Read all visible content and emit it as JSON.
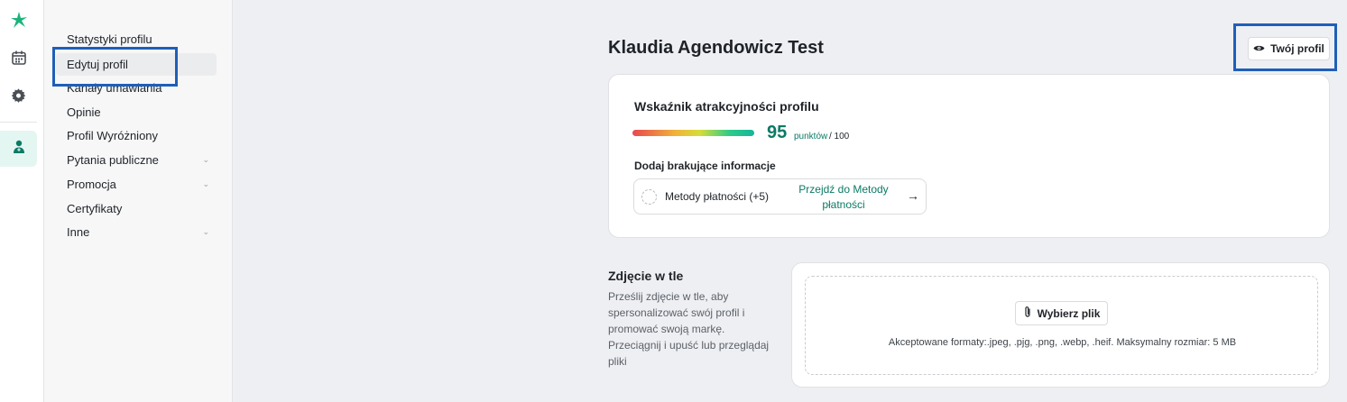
{
  "rail": {
    "items": [
      {
        "name": "logo",
        "icon": "asterisk-logo-icon"
      },
      {
        "name": "calendar",
        "icon": "calendar-icon"
      },
      {
        "name": "settings",
        "icon": "gear-icon"
      },
      {
        "name": "profile",
        "icon": "doctor-icon",
        "active": true
      }
    ]
  },
  "subnav": {
    "items": [
      {
        "label": "Statystyki profilu",
        "expandable": false
      },
      {
        "label": "Edytuj profil",
        "expandable": false,
        "active": true
      },
      {
        "label": "Kanały umawiania",
        "expandable": false
      },
      {
        "label": "Opinie",
        "expandable": false
      },
      {
        "label": "Profil Wyróżniony",
        "expandable": false
      },
      {
        "label": "Pytania publiczne",
        "expandable": true
      },
      {
        "label": "Promocja",
        "expandable": true
      },
      {
        "label": "Certyfikaty",
        "expandable": false
      },
      {
        "label": "Inne",
        "expandable": true
      }
    ]
  },
  "header": {
    "title": "Klaudia Agendowicz Test",
    "profile_button": "Twój profil"
  },
  "score": {
    "title": "Wskaźnik atrakcyjności profilu",
    "value": "95",
    "unit": "punktów",
    "max": "/ 100",
    "missing_title": "Dodaj brakujące informacje",
    "missing_item": {
      "label": "Metody płatności (+5)",
      "link": "Przejdź do Metody płatności"
    }
  },
  "background": {
    "title": "Zdjęcie w tle",
    "description": "Prześlij zdjęcie w tle, aby spersonalizować swój profil i promować swoją markę. Przeciągnij i upuść lub przeglądaj pliki",
    "button": "Wybierz plik",
    "formats": "Akceptowane formaty:.jpeg, .pjg, .png, .webp, .heif. Maksymalny rozmiar: 5 MB"
  },
  "colors": {
    "accent": "#0b7a66",
    "highlight": "#1f5fb8",
    "background": "#eeeff3"
  }
}
